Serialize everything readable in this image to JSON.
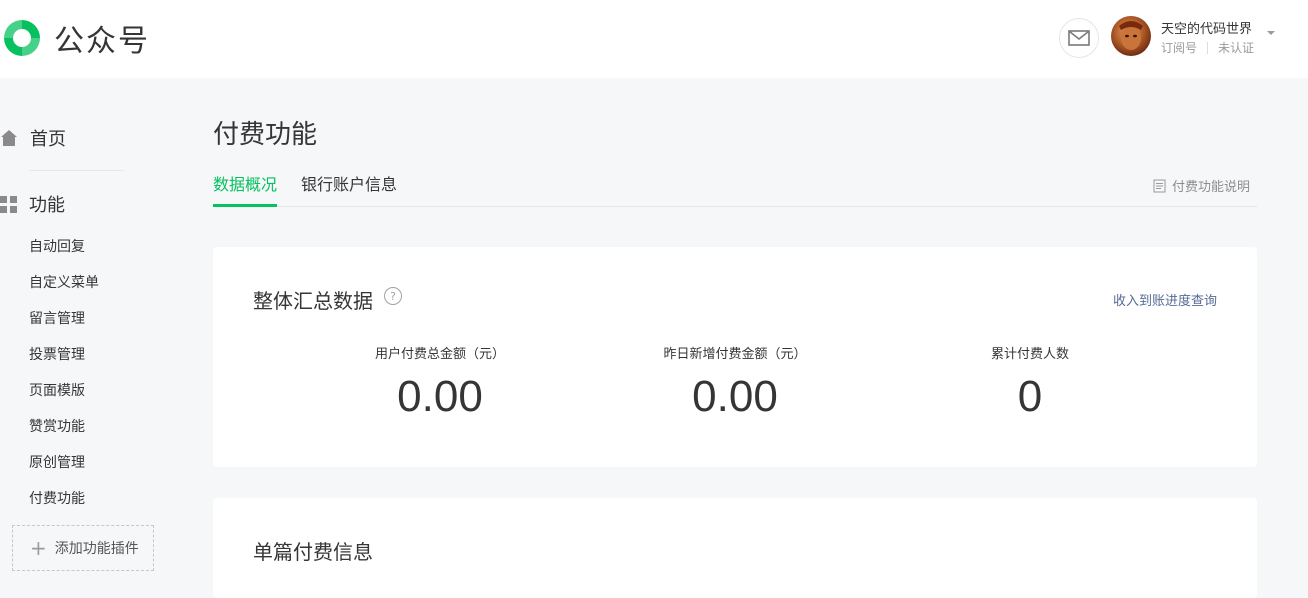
{
  "header": {
    "logo_text": "公众号",
    "account": {
      "name": "天空的代码世界",
      "type": "订阅号",
      "verification": "未认证"
    }
  },
  "sidebar": {
    "home_label": "首页",
    "functions_label": "功能",
    "items": [
      {
        "label": "自动回复"
      },
      {
        "label": "自定义菜单"
      },
      {
        "label": "留言管理"
      },
      {
        "label": "投票管理"
      },
      {
        "label": "页面模版"
      },
      {
        "label": "赞赏功能"
      },
      {
        "label": "原创管理"
      },
      {
        "label": "付费功能"
      }
    ],
    "add_plugin_label": "添加功能插件"
  },
  "main": {
    "title": "付费功能",
    "tabs": [
      {
        "label": "数据概况",
        "active": true
      },
      {
        "label": "银行账户信息",
        "active": false
      }
    ],
    "doc_link": "付费功能说明",
    "summary": {
      "title": "整体汇总数据",
      "help_symbol": "?",
      "progress_link": "收入到账进度查询",
      "stats": [
        {
          "label": "用户付费总金额（元）",
          "value": "0.00"
        },
        {
          "label": "昨日新增付费金额（元）",
          "value": "0.00"
        },
        {
          "label": "累计付费人数",
          "value": "0"
        }
      ]
    },
    "single": {
      "title": "单篇付费信息"
    }
  },
  "colors": {
    "accent": "#07c160",
    "link": "#576b95",
    "background": "#f6f7f9"
  }
}
